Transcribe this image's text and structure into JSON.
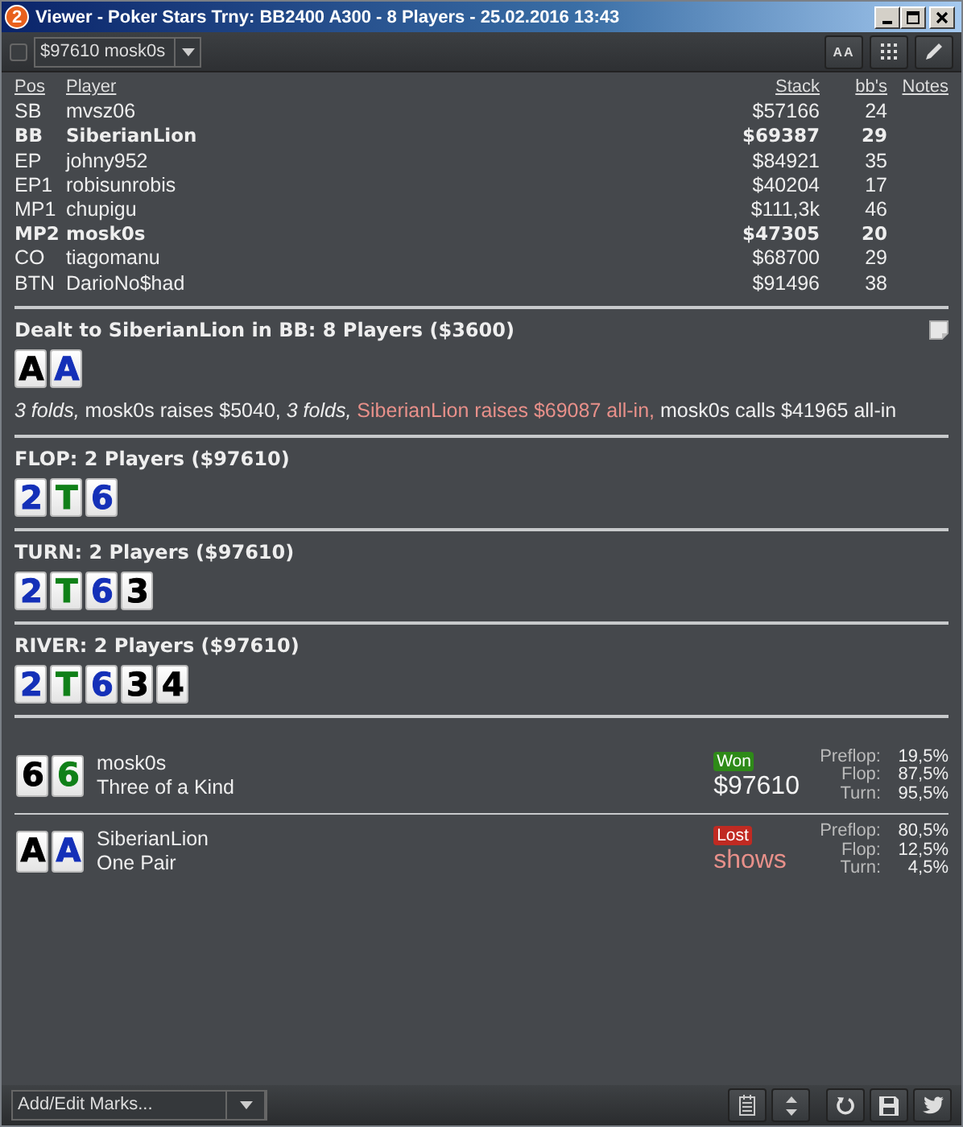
{
  "window": {
    "badge": "2",
    "title": "Viewer - Poker Stars Trny: BB2400 A300 - 8 Players - 25.02.2016 13:43"
  },
  "toolbar": {
    "checkbox": {
      "checked": false
    },
    "hand_select": {
      "value": "$97610 mosk0s"
    },
    "buttons": [
      {
        "kind": "font",
        "label": "AA"
      },
      {
        "kind": "grid"
      },
      {
        "kind": "edit"
      }
    ]
  },
  "players": {
    "columns": [
      "Pos",
      "Player",
      "Stack",
      "bb's",
      "Notes"
    ],
    "rows": [
      {
        "pos": "SB",
        "player": "mvsz06",
        "stack": "$57166",
        "bbs": "24",
        "highlighted": false
      },
      {
        "pos": "BB",
        "player": "SiberianLion",
        "stack": "$69387",
        "bbs": "29",
        "highlighted": true
      },
      {
        "pos": "EP",
        "player": "johny952",
        "stack": "$84921",
        "bbs": "35",
        "highlighted": false
      },
      {
        "pos": "EP1",
        "player": "robisunrobis",
        "stack": "$40204",
        "bbs": "17",
        "highlighted": false
      },
      {
        "pos": "MP1",
        "player": "chupigu",
        "stack": "$111,3k",
        "bbs": "46",
        "highlighted": false
      },
      {
        "pos": "MP2",
        "player": "mosk0s",
        "stack": "$47305",
        "bbs": "20",
        "highlighted": true
      },
      {
        "pos": "CO",
        "player": "tiagomanu",
        "stack": "$68700",
        "bbs": "29",
        "highlighted": false
      },
      {
        "pos": "BTN",
        "player": "DarioNo$had",
        "stack": "$91496",
        "bbs": "38",
        "highlighted": false
      }
    ]
  },
  "streets": [
    {
      "kind": "preflop",
      "title": "Dealt to SiberianLion in BB: 8 Players ($3600)",
      "cards": [
        {
          "rank": "A",
          "color": "#000000"
        },
        {
          "rank": "A",
          "color": "#1430b8"
        }
      ],
      "actions": [
        {
          "kind": "fold",
          "text": "3 folds,"
        },
        {
          "kind": "action",
          "text": "mosk0s raises $5040,"
        },
        {
          "kind": "fold",
          "text": "3 folds,"
        },
        {
          "kind": "allin",
          "text": "SiberianLion raises $69087 all-in,"
        },
        {
          "kind": "action",
          "text": "mosk0s calls $41965 all-in"
        }
      ]
    },
    {
      "kind": "board",
      "title": "FLOP: 2 Players ($97610)",
      "cards": [
        {
          "rank": "2",
          "color": "#1430b8"
        },
        {
          "rank": "T",
          "color": "#108018"
        },
        {
          "rank": "6",
          "color": "#1430b8"
        }
      ]
    },
    {
      "kind": "board",
      "title": "TURN: 2 Players ($97610)",
      "cards": [
        {
          "rank": "2",
          "color": "#1430b8"
        },
        {
          "rank": "T",
          "color": "#108018"
        },
        {
          "rank": "6",
          "color": "#1430b8"
        },
        {
          "rank": "3",
          "color": "#000000"
        }
      ]
    },
    {
      "kind": "board",
      "title": "RIVER: 2 Players ($97610)",
      "cards": [
        {
          "rank": "2",
          "color": "#1430b8"
        },
        {
          "rank": "T",
          "color": "#108018"
        },
        {
          "rank": "6",
          "color": "#1430b8"
        },
        {
          "rank": "3",
          "color": "#000000"
        },
        {
          "rank": "4",
          "color": "#000000"
        }
      ]
    }
  ],
  "results": [
    {
      "cards": [
        {
          "rank": "6",
          "color": "#000000"
        },
        {
          "rank": "6",
          "color": "#108018"
        }
      ],
      "player": "mosk0s",
      "hand": "Three of a Kind",
      "outcome": {
        "kind": "won",
        "label": "Won"
      },
      "amount": "$97610",
      "equity": [
        {
          "label": "Preflop:",
          "value": "19,5%"
        },
        {
          "label": "Flop:",
          "value": "87,5%"
        },
        {
          "label": "Turn:",
          "value": "95,5%"
        }
      ]
    },
    {
      "cards": [
        {
          "rank": "A",
          "color": "#000000"
        },
        {
          "rank": "A",
          "color": "#1430b8"
        }
      ],
      "player": "SiberianLion",
      "hand": "One Pair",
      "outcome": {
        "kind": "lost",
        "label": "Lost"
      },
      "amount": "shows",
      "equity": [
        {
          "label": "Preflop:",
          "value": "80,5%"
        },
        {
          "label": "Flop:",
          "value": "12,5%"
        },
        {
          "label": "Turn:",
          "value": "4,5%"
        }
      ]
    }
  ],
  "bottom": {
    "marks": {
      "value": "Add/Edit Marks..."
    },
    "buttons": [
      {
        "kind": "notes"
      },
      {
        "kind": "refresh"
      },
      {
        "kind": "save"
      },
      {
        "kind": "bird"
      }
    ]
  }
}
